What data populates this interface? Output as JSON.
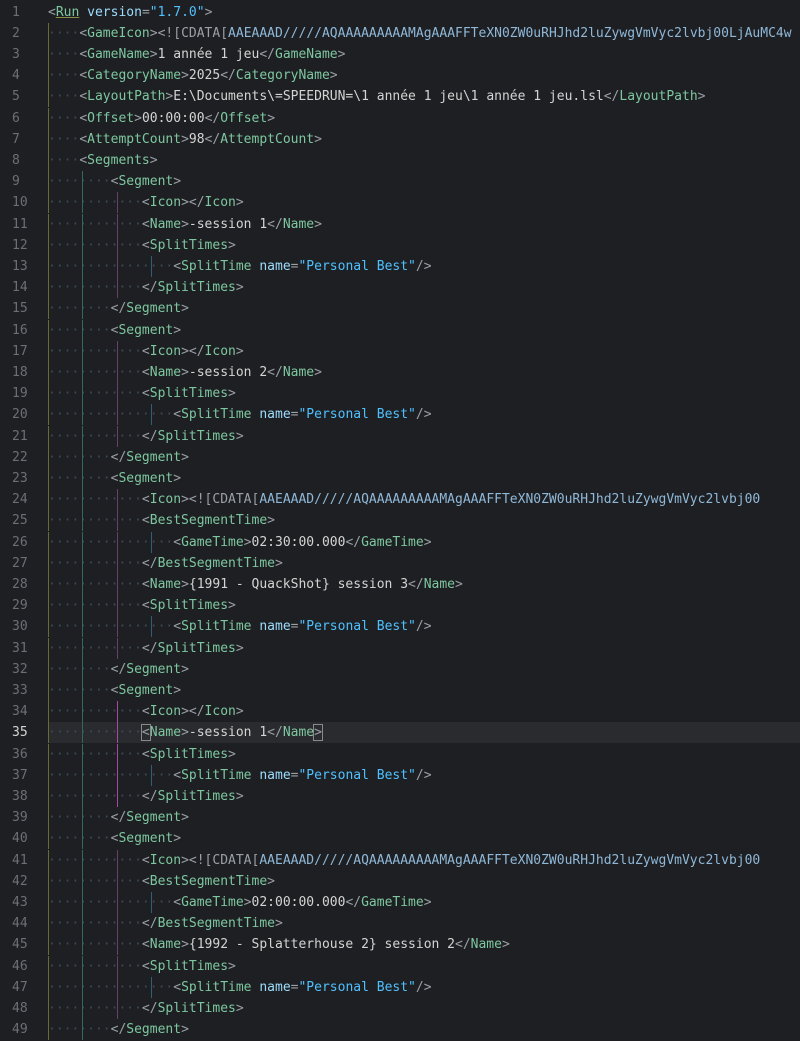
{
  "editor": {
    "active_line": 35,
    "lines": [
      {
        "n": "1",
        "t": [
          [
            "p",
            "<"
          ],
          [
            "t",
            "Run"
          ],
          [
            "x",
            " "
          ],
          [
            "a",
            "version"
          ],
          [
            "p",
            "="
          ],
          [
            "s",
            "\"1.7.0\""
          ],
          [
            "p",
            ">"
          ]
        ]
      },
      {
        "n": "2",
        "t": [
          [
            "p",
            "<"
          ],
          [
            "t",
            "GameIcon"
          ],
          [
            "p",
            ">"
          ],
          [
            "p",
            "<![CDATA["
          ],
          [
            "cd",
            "AAEAAAD/////AQAAAAAAAAAMAgAAAFFTeXN0ZW0uRHJhd2luZywgVmVyc2lvbj00LjAuMC4w"
          ]
        ]
      },
      {
        "n": "3",
        "t": [
          [
            "p",
            "<"
          ],
          [
            "t",
            "GameName"
          ],
          [
            "p",
            ">"
          ],
          [
            "x",
            "1 année 1 jeu"
          ],
          [
            "p",
            "</"
          ],
          [
            "t",
            "GameName"
          ],
          [
            "p",
            ">"
          ]
        ]
      },
      {
        "n": "4",
        "t": [
          [
            "p",
            "<"
          ],
          [
            "t",
            "CategoryName"
          ],
          [
            "p",
            ">"
          ],
          [
            "x",
            "2025"
          ],
          [
            "p",
            "</"
          ],
          [
            "t",
            "CategoryName"
          ],
          [
            "p",
            ">"
          ]
        ]
      },
      {
        "n": "5",
        "t": [
          [
            "p",
            "<"
          ],
          [
            "t",
            "LayoutPath"
          ],
          [
            "p",
            ">"
          ],
          [
            "x",
            "E:\\Documents\\=SPEEDRUN=\\1 année 1 jeu\\1 année 1 jeu.lsl"
          ],
          [
            "p",
            "</"
          ],
          [
            "t",
            "LayoutPath"
          ],
          [
            "p",
            ">"
          ]
        ]
      },
      {
        "n": "6",
        "t": [
          [
            "p",
            "<"
          ],
          [
            "t",
            "Offset"
          ],
          [
            "p",
            ">"
          ],
          [
            "x",
            "00:00:00"
          ],
          [
            "p",
            "</"
          ],
          [
            "t",
            "Offset"
          ],
          [
            "p",
            ">"
          ]
        ]
      },
      {
        "n": "7",
        "t": [
          [
            "p",
            "<"
          ],
          [
            "t",
            "AttemptCount"
          ],
          [
            "p",
            ">"
          ],
          [
            "x",
            "98"
          ],
          [
            "p",
            "</"
          ],
          [
            "t",
            "AttemptCount"
          ],
          [
            "p",
            ">"
          ]
        ]
      },
      {
        "n": "8",
        "t": [
          [
            "p",
            "<"
          ],
          [
            "t",
            "Segments"
          ],
          [
            "p",
            ">"
          ]
        ]
      },
      {
        "n": "9",
        "t": [
          [
            "p",
            "<"
          ],
          [
            "t",
            "Segment"
          ],
          [
            "p",
            ">"
          ]
        ]
      },
      {
        "n": "10",
        "t": [
          [
            "p",
            "<"
          ],
          [
            "t",
            "Icon"
          ],
          [
            "p",
            "></"
          ],
          [
            "t",
            "Icon"
          ],
          [
            "p",
            ">"
          ]
        ]
      },
      {
        "n": "11",
        "t": [
          [
            "p",
            "<"
          ],
          [
            "t",
            "Name"
          ],
          [
            "p",
            ">"
          ],
          [
            "x",
            "-session 1"
          ],
          [
            "p",
            "</"
          ],
          [
            "t",
            "Name"
          ],
          [
            "p",
            ">"
          ]
        ]
      },
      {
        "n": "12",
        "t": [
          [
            "p",
            "<"
          ],
          [
            "t",
            "SplitTimes"
          ],
          [
            "p",
            ">"
          ]
        ]
      },
      {
        "n": "13",
        "t": [
          [
            "p",
            "<"
          ],
          [
            "t",
            "SplitTime"
          ],
          [
            "x",
            " "
          ],
          [
            "a",
            "name"
          ],
          [
            "p",
            "="
          ],
          [
            "s",
            "\"Personal Best\""
          ],
          [
            "p",
            "/>"
          ]
        ]
      },
      {
        "n": "14",
        "t": [
          [
            "p",
            "</"
          ],
          [
            "t",
            "SplitTimes"
          ],
          [
            "p",
            ">"
          ]
        ]
      },
      {
        "n": "15",
        "t": [
          [
            "p",
            "</"
          ],
          [
            "t",
            "Segment"
          ],
          [
            "p",
            ">"
          ]
        ]
      },
      {
        "n": "16",
        "t": [
          [
            "p",
            "<"
          ],
          [
            "t",
            "Segment"
          ],
          [
            "p",
            ">"
          ]
        ]
      },
      {
        "n": "17",
        "t": [
          [
            "p",
            "<"
          ],
          [
            "t",
            "Icon"
          ],
          [
            "p",
            "></"
          ],
          [
            "t",
            "Icon"
          ],
          [
            "p",
            ">"
          ]
        ]
      },
      {
        "n": "18",
        "t": [
          [
            "p",
            "<"
          ],
          [
            "t",
            "Name"
          ],
          [
            "p",
            ">"
          ],
          [
            "x",
            "-session 2"
          ],
          [
            "p",
            "</"
          ],
          [
            "t",
            "Name"
          ],
          [
            "p",
            ">"
          ]
        ]
      },
      {
        "n": "19",
        "t": [
          [
            "p",
            "<"
          ],
          [
            "t",
            "SplitTimes"
          ],
          [
            "p",
            ">"
          ]
        ]
      },
      {
        "n": "20",
        "t": [
          [
            "p",
            "<"
          ],
          [
            "t",
            "SplitTime"
          ],
          [
            "x",
            " "
          ],
          [
            "a",
            "name"
          ],
          [
            "p",
            "="
          ],
          [
            "s",
            "\"Personal Best\""
          ],
          [
            "p",
            "/>"
          ]
        ]
      },
      {
        "n": "21",
        "t": [
          [
            "p",
            "</"
          ],
          [
            "t",
            "SplitTimes"
          ],
          [
            "p",
            ">"
          ]
        ]
      },
      {
        "n": "22",
        "t": [
          [
            "p",
            "</"
          ],
          [
            "t",
            "Segment"
          ],
          [
            "p",
            ">"
          ]
        ]
      },
      {
        "n": "23",
        "t": [
          [
            "p",
            "<"
          ],
          [
            "t",
            "Segment"
          ],
          [
            "p",
            ">"
          ]
        ]
      },
      {
        "n": "24",
        "t": [
          [
            "p",
            "<"
          ],
          [
            "t",
            "Icon"
          ],
          [
            "p",
            ">"
          ],
          [
            "p",
            "<![CDATA["
          ],
          [
            "cd",
            "AAEAAAD/////AQAAAAAAAAAMAgAAAFFTeXN0ZW0uRHJhd2luZywgVmVyc2lvbj00"
          ]
        ]
      },
      {
        "n": "25",
        "t": [
          [
            "p",
            "<"
          ],
          [
            "t",
            "BestSegmentTime"
          ],
          [
            "p",
            ">"
          ]
        ]
      },
      {
        "n": "26",
        "t": [
          [
            "p",
            "<"
          ],
          [
            "t",
            "GameTime"
          ],
          [
            "p",
            ">"
          ],
          [
            "x",
            "02:30:00.000"
          ],
          [
            "p",
            "</"
          ],
          [
            "t",
            "GameTime"
          ],
          [
            "p",
            ">"
          ]
        ]
      },
      {
        "n": "27",
        "t": [
          [
            "p",
            "</"
          ],
          [
            "t",
            "BestSegmentTime"
          ],
          [
            "p",
            ">"
          ]
        ]
      },
      {
        "n": "28",
        "t": [
          [
            "p",
            "<"
          ],
          [
            "t",
            "Name"
          ],
          [
            "p",
            ">"
          ],
          [
            "x",
            "{1991 - QuackShot} session 3"
          ],
          [
            "p",
            "</"
          ],
          [
            "t",
            "Name"
          ],
          [
            "p",
            ">"
          ]
        ]
      },
      {
        "n": "29",
        "t": [
          [
            "p",
            "<"
          ],
          [
            "t",
            "SplitTimes"
          ],
          [
            "p",
            ">"
          ]
        ]
      },
      {
        "n": "30",
        "t": [
          [
            "p",
            "<"
          ],
          [
            "t",
            "SplitTime"
          ],
          [
            "x",
            " "
          ],
          [
            "a",
            "name"
          ],
          [
            "p",
            "="
          ],
          [
            "s",
            "\"Personal Best\""
          ],
          [
            "p",
            "/>"
          ]
        ]
      },
      {
        "n": "31",
        "t": [
          [
            "p",
            "</"
          ],
          [
            "t",
            "SplitTimes"
          ],
          [
            "p",
            ">"
          ]
        ]
      },
      {
        "n": "32",
        "t": [
          [
            "p",
            "</"
          ],
          [
            "t",
            "Segment"
          ],
          [
            "p",
            ">"
          ]
        ]
      },
      {
        "n": "33",
        "t": [
          [
            "p",
            "<"
          ],
          [
            "t",
            "Segment"
          ],
          [
            "p",
            ">"
          ]
        ]
      },
      {
        "n": "34",
        "t": [
          [
            "p",
            "<"
          ],
          [
            "t",
            "Icon"
          ],
          [
            "p",
            "></"
          ],
          [
            "t",
            "Icon"
          ],
          [
            "p",
            ">"
          ]
        ]
      },
      {
        "n": "35",
        "t": [
          [
            "p",
            "<"
          ],
          [
            "t",
            "Name"
          ],
          [
            "p",
            ">"
          ],
          [
            "x",
            "-session 1"
          ],
          [
            "p",
            "</"
          ],
          [
            "t",
            "Name"
          ],
          [
            "p",
            ">"
          ]
        ]
      },
      {
        "n": "36",
        "t": [
          [
            "p",
            "<"
          ],
          [
            "t",
            "SplitTimes"
          ],
          [
            "p",
            ">"
          ]
        ]
      },
      {
        "n": "37",
        "t": [
          [
            "p",
            "<"
          ],
          [
            "t",
            "SplitTime"
          ],
          [
            "x",
            " "
          ],
          [
            "a",
            "name"
          ],
          [
            "p",
            "="
          ],
          [
            "s",
            "\"Personal Best\""
          ],
          [
            "p",
            "/>"
          ]
        ]
      },
      {
        "n": "38",
        "t": [
          [
            "p",
            "</"
          ],
          [
            "t",
            "SplitTimes"
          ],
          [
            "p",
            ">"
          ]
        ]
      },
      {
        "n": "39",
        "t": [
          [
            "p",
            "</"
          ],
          [
            "t",
            "Segment"
          ],
          [
            "p",
            ">"
          ]
        ]
      },
      {
        "n": "40",
        "t": [
          [
            "p",
            "<"
          ],
          [
            "t",
            "Segment"
          ],
          [
            "p",
            ">"
          ]
        ]
      },
      {
        "n": "41",
        "t": [
          [
            "p",
            "<"
          ],
          [
            "t",
            "Icon"
          ],
          [
            "p",
            ">"
          ],
          [
            "p",
            "<![CDATA["
          ],
          [
            "cd",
            "AAEAAAD/////AQAAAAAAAAAMAgAAAFFTeXN0ZW0uRHJhd2luZywgVmVyc2lvbj00"
          ]
        ]
      },
      {
        "n": "42",
        "t": [
          [
            "p",
            "<"
          ],
          [
            "t",
            "BestSegmentTime"
          ],
          [
            "p",
            ">"
          ]
        ]
      },
      {
        "n": "43",
        "t": [
          [
            "p",
            "<"
          ],
          [
            "t",
            "GameTime"
          ],
          [
            "p",
            ">"
          ],
          [
            "x",
            "02:00:00.000"
          ],
          [
            "p",
            "</"
          ],
          [
            "t",
            "GameTime"
          ],
          [
            "p",
            ">"
          ]
        ]
      },
      {
        "n": "44",
        "t": [
          [
            "p",
            "</"
          ],
          [
            "t",
            "BestSegmentTime"
          ],
          [
            "p",
            ">"
          ]
        ]
      },
      {
        "n": "45",
        "t": [
          [
            "p",
            "<"
          ],
          [
            "t",
            "Name"
          ],
          [
            "p",
            ">"
          ],
          [
            "x",
            "{1992 - Splatterhouse 2} session 2"
          ],
          [
            "p",
            "</"
          ],
          [
            "t",
            "Name"
          ],
          [
            "p",
            ">"
          ]
        ]
      },
      {
        "n": "46",
        "t": [
          [
            "p",
            "<"
          ],
          [
            "t",
            "SplitTimes"
          ],
          [
            "p",
            ">"
          ]
        ]
      },
      {
        "n": "47",
        "t": [
          [
            "p",
            "<"
          ],
          [
            "t",
            "SplitTime"
          ],
          [
            "x",
            " "
          ],
          [
            "a",
            "name"
          ],
          [
            "p",
            "="
          ],
          [
            "s",
            "\"Personal Best\""
          ],
          [
            "p",
            "/>"
          ]
        ]
      },
      {
        "n": "48",
        "t": [
          [
            "p",
            "</"
          ],
          [
            "t",
            "SplitTimes"
          ],
          [
            "p",
            ">"
          ]
        ]
      },
      {
        "n": "49",
        "t": [
          [
            "p",
            "</"
          ],
          [
            "t",
            "Segment"
          ],
          [
            "p",
            ">"
          ]
        ]
      }
    ]
  }
}
